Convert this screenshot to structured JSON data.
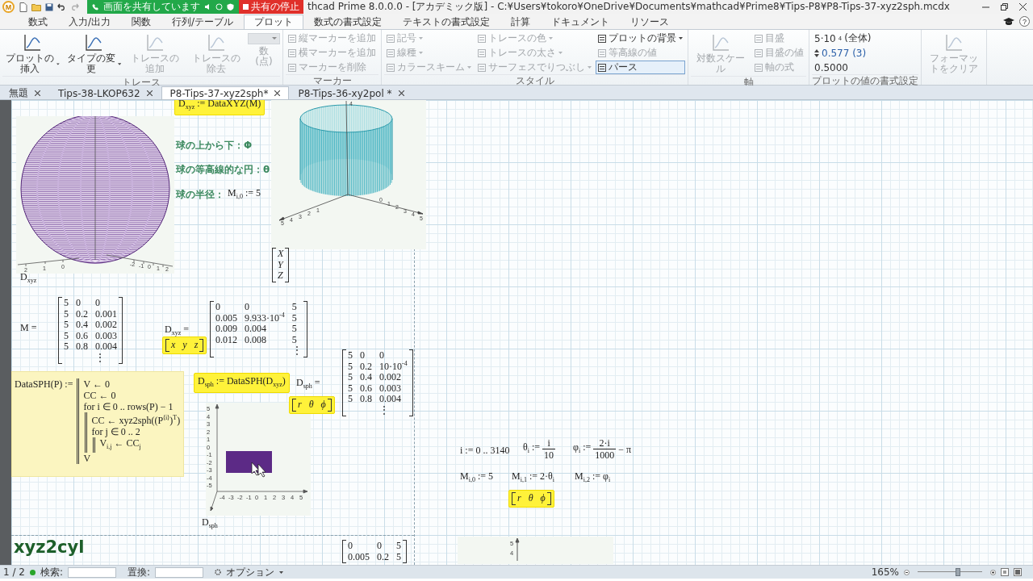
{
  "window": {
    "logo": "M",
    "title": "thcad Prime 8.0.0.0 - [アカデミック版] - C:¥Users¥tokoro¥OneDrive¥Documents¥mathcad¥Prime8¥Tips-P8¥P8-Tips-37-xyz2sph.mcdx"
  },
  "share_banner": {
    "status": "画面を共有しています",
    "stop_button": "共有の停止"
  },
  "ribbon_tabs": [
    {
      "label": "数式",
      "selected": false
    },
    {
      "label": "入力/出力",
      "selected": false
    },
    {
      "label": "関数",
      "selected": false
    },
    {
      "label": "行列/テーブル",
      "selected": false
    },
    {
      "label": "プロット",
      "selected": true
    },
    {
      "label": "数式の書式設定",
      "selected": false
    },
    {
      "label": "テキストの書式設定",
      "selected": false
    },
    {
      "label": "計算",
      "selected": false
    },
    {
      "label": "ドキュメント",
      "selected": false
    },
    {
      "label": "リソース",
      "selected": false
    }
  ],
  "help_button": "?",
  "ribbon_groups": [
    {
      "label": "トレース",
      "columns": [
        [
          {
            "kind": "large",
            "label": "プロットの挿入",
            "disabled": false,
            "dropdown": true
          }
        ],
        [
          {
            "kind": "large",
            "label": "タイプの変更",
            "disabled": false,
            "dropdown": true
          }
        ],
        [
          {
            "kind": "large",
            "label": "トレースの追加",
            "disabled": true,
            "dropdown": false
          }
        ],
        [
          {
            "kind": "large",
            "label": "トレースの除去",
            "disabled": true,
            "dropdown": false
          }
        ],
        [
          {
            "kind": "combo",
            "label": "数\n(点)",
            "disabled": true
          }
        ]
      ]
    },
    {
      "label": "マーカー",
      "columns": [
        [
          {
            "kind": "small",
            "label": "縦マーカーを追加",
            "disabled": true,
            "dropdown": false
          },
          {
            "kind": "small",
            "label": "横マーカーを追加",
            "disabled": true,
            "dropdown": false
          },
          {
            "kind": "small",
            "label": "マーカーを削除",
            "disabled": true,
            "dropdown": false
          }
        ]
      ]
    },
    {
      "label": "スタイル",
      "columns": [
        [
          {
            "kind": "small",
            "label": "記号",
            "disabled": true,
            "dropdown": true
          },
          {
            "kind": "small",
            "label": "線種",
            "disabled": true,
            "dropdown": true
          },
          {
            "kind": "small",
            "label": "カラースキーム",
            "disabled": true,
            "dropdown": true
          }
        ],
        [
          {
            "kind": "small",
            "label": "トレースの色",
            "disabled": true,
            "dropdown": true
          },
          {
            "kind": "small",
            "label": "トレースの太さ",
            "disabled": true,
            "dropdown": true
          },
          {
            "kind": "small",
            "label": "サーフェスでりつぶし",
            "disabled": true,
            "dropdown": true
          }
        ],
        [
          {
            "kind": "small",
            "label": "プロットの背景",
            "disabled": false,
            "dropdown": true,
            "on": false
          },
          {
            "kind": "small",
            "label": "等高線の値",
            "disabled": true,
            "dropdown": false,
            "on": false
          },
          {
            "kind": "small",
            "label": "パース",
            "disabled": false,
            "dropdown": false,
            "on": true
          }
        ]
      ]
    },
    {
      "label": "軸",
      "columns": [
        [
          {
            "kind": "large",
            "label": "対数スケール",
            "disabled": true,
            "dropdown": false
          }
        ],
        [
          {
            "kind": "small",
            "label": "目盛",
            "disabled": true,
            "dropdown": false
          },
          {
            "kind": "small",
            "label": "目盛の値",
            "disabled": true,
            "dropdown": false
          },
          {
            "kind": "small",
            "label": "軸の式",
            "disabled": true,
            "dropdown": false
          }
        ]
      ]
    },
    {
      "label": "プロットの値の書式設定",
      "columns": [
        [
          {
            "kind": "value",
            "label": "5·10$^{4}$ (全体)",
            "disabled": false
          },
          {
            "kind": "spin",
            "label": "0.577 (3)",
            "disabled": false
          },
          {
            "kind": "value",
            "label": "0.5000",
            "disabled": false
          }
        ]
      ]
    },
    {
      "columns": [
        [
          {
            "kind": "large",
            "label": "フォーマットをクリア",
            "disabled": true,
            "dropdown": false
          }
        ]
      ]
    }
  ],
  "doc_tabs": [
    {
      "label": "無題",
      "selected": false
    },
    {
      "label": "Tips-38-LKOP632",
      "selected": false
    },
    {
      "label": "P8-Tips-37-xyz2sph*",
      "selected": true
    },
    {
      "label": "P8-Tips-36-xy2pol *",
      "selected": false
    }
  ],
  "worksheet": {
    "cut_definition": "D$_{xyz}$ := DataXYZ(M)",
    "sphere_plot": {
      "axis_left_ticks": [
        "2",
        "1",
        "0"
      ],
      "axis_right_ticks": [
        "-2",
        "-1",
        "0",
        "1",
        "2"
      ],
      "variable": "D$_{xyz}$"
    },
    "notes": [
      "球の上から下：Φ",
      "球の等高線的な円：θ",
      "球の半径："
    ],
    "radius_definition": "M$_{i,0}$ := 5",
    "cylinder_plot": {
      "z_ticks": [
        "4"
      ],
      "axis_left_ticks": [
        "5",
        "4",
        "3",
        "2",
        "1"
      ],
      "axis_right_ticks": [
        "0",
        "1",
        "2",
        "3",
        "4",
        "5"
      ]
    },
    "axis_vector": [
      "X",
      "Y",
      "Z"
    ],
    "m_display": {
      "label": "M =",
      "rows": [
        [
          "5",
          "0",
          "0"
        ],
        [
          "5",
          "0.2",
          "0.001"
        ],
        [
          "5",
          "0.4",
          "0.002"
        ],
        [
          "5",
          "0.6",
          "0.003"
        ],
        [
          "5",
          "0.8",
          "0.004"
        ],
        [
          "",
          "",
          "⋮"
        ]
      ]
    },
    "dxyz_display": {
      "label": "D$_{xyz}$ =",
      "column_labels": [
        "x",
        "y",
        "z"
      ],
      "rows": [
        [
          "0",
          "0",
          "5"
        ],
        [
          "0.005",
          "9.933·10$^{-4}$",
          "5"
        ],
        [
          "0.009",
          "0.004",
          "5"
        ],
        [
          "0.012",
          "0.008",
          "5"
        ],
        [
          "",
          "",
          "⋮"
        ]
      ]
    },
    "program": {
      "header": "DataSPH(P) :=",
      "lines": [
        {
          "text": "V ← 0"
        },
        {
          "text": "CC ← 0"
        },
        {
          "text": "for i ∈ 0 .. rows(P) − 1",
          "children": [
            {
              "text": "CC ← xyz2sph((P$^{⟨i⟩}$)$^{T}$)"
            },
            {
              "text": "for j ∈ 0 .. 2",
              "children": [
                {
                  "text": "V$_{i,j}$ ← CC$_{j}$"
                }
              ]
            }
          ]
        },
        {
          "text": "V"
        }
      ]
    },
    "dsph_definition": "D$_{sph}$ := DataSPH(D$_{xyz}$)",
    "dsph_display": {
      "label": "D$_{sph}$ =",
      "column_labels": [
        "r",
        "θ",
        "ϕ"
      ],
      "rows": [
        [
          "5",
          "0",
          "0"
        ],
        [
          "5",
          "0.2",
          "10·10$^{-4}$"
        ],
        [
          "5",
          "0.4",
          "0.002"
        ],
        [
          "5",
          "0.6",
          "0.003"
        ],
        [
          "5",
          "0.8",
          "0.004"
        ],
        [
          "",
          "",
          "⋮"
        ]
      ]
    },
    "sph_plot": {
      "y_ticks": [
        "5",
        "4",
        "3",
        "2",
        "1",
        "0",
        "-1",
        "-2",
        "-3",
        "-4",
        "-5"
      ],
      "x_ticks": [
        "-4",
        "-3",
        "-2",
        "-1",
        "0",
        "1",
        "2",
        "3",
        "4",
        "5"
      ],
      "variable": "D$_{sph}$"
    },
    "definitions": [
      [
        {
          "kind": "text",
          "text": "i := 0 .. 3140"
        },
        {
          "kind": "fraction",
          "lhs": "θ$_{i}$ :=",
          "numerator": "i",
          "denominator": "10"
        },
        {
          "kind": "fraction",
          "lhs": "φ$_{i}$ :=",
          "numerator": "2·i",
          "denominator": "1000",
          "suffix": "− π"
        }
      ],
      [
        {
          "kind": "text",
          "text": "M$_{i,0}$ := 5"
        },
        {
          "kind": "text",
          "text": "M$_{i,1}$ := 2·θ$_{i}$"
        },
        {
          "kind": "text",
          "text": "M$_{i,2}$ := φ$_{i}$"
        }
      ]
    ],
    "definitions_labels": [
      "r",
      "θ",
      "ϕ"
    ],
    "heading": "xyz2cyl",
    "bottom_matrix": [
      [
        "0",
        "0",
        "5"
      ],
      [
        "0.005",
        "0.2",
        "5"
      ]
    ],
    "bottom_plot": {
      "z_ticks": [
        "5",
        "4"
      ]
    }
  },
  "status_bar": {
    "page": "1 / 2",
    "search_label": "検索:",
    "replace_label": "置換:",
    "options": "オプション",
    "zoom": "165%",
    "zoom_slider": {
      "level": 0.62
    }
  }
}
